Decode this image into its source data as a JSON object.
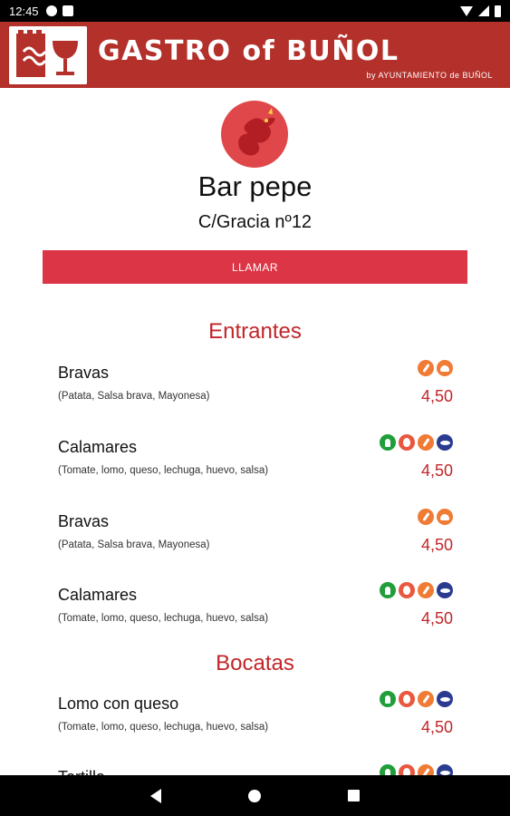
{
  "status_bar": {
    "time": "12:45"
  },
  "header": {
    "title": "GASTRO of BUÑOL",
    "subtitle": "by AYUNTAMIENTO de BUÑOL",
    "brand_color": "#b3302b"
  },
  "restaurant": {
    "name": "Bar pepe",
    "address": "C/Gracia nº12",
    "call_label": "LLAMAR",
    "accent_color": "#dc3545"
  },
  "sections": [
    {
      "title": "Entrantes",
      "items": [
        {
          "name": "Bravas",
          "description": "(Patata, Salsa brava, Mayonesa)",
          "price": "4,50",
          "icons": [
            "leaf-icon",
            "cloud-icon"
          ]
        },
        {
          "name": "Calamares",
          "description": "(Tomate, lomo, queso, lechuga, huevo, salsa)",
          "price": "4,50",
          "icons": [
            "drop-icon",
            "egg-icon",
            "leaf-icon",
            "fish-icon"
          ]
        },
        {
          "name": "Bravas",
          "description": "(Patata, Salsa brava, Mayonesa)",
          "price": "4,50",
          "icons": [
            "leaf-icon",
            "cloud-icon"
          ]
        },
        {
          "name": "Calamares",
          "description": "(Tomate, lomo, queso, lechuga, huevo, salsa)",
          "price": "4,50",
          "icons": [
            "drop-icon",
            "egg-icon",
            "leaf-icon",
            "fish-icon"
          ]
        }
      ]
    },
    {
      "title": "Bocatas",
      "items": [
        {
          "name": "Lomo con queso",
          "description": "(Tomate, lomo, queso, lechuga, huevo, salsa)",
          "price": "4,50",
          "icons": [
            "drop-icon",
            "egg-icon",
            "leaf-icon",
            "fish-icon"
          ]
        },
        {
          "name": "Tortilla",
          "description": "",
          "price": "",
          "icons": [
            "drop-icon",
            "egg-icon",
            "leaf-icon",
            "fish-icon"
          ]
        }
      ]
    }
  ]
}
